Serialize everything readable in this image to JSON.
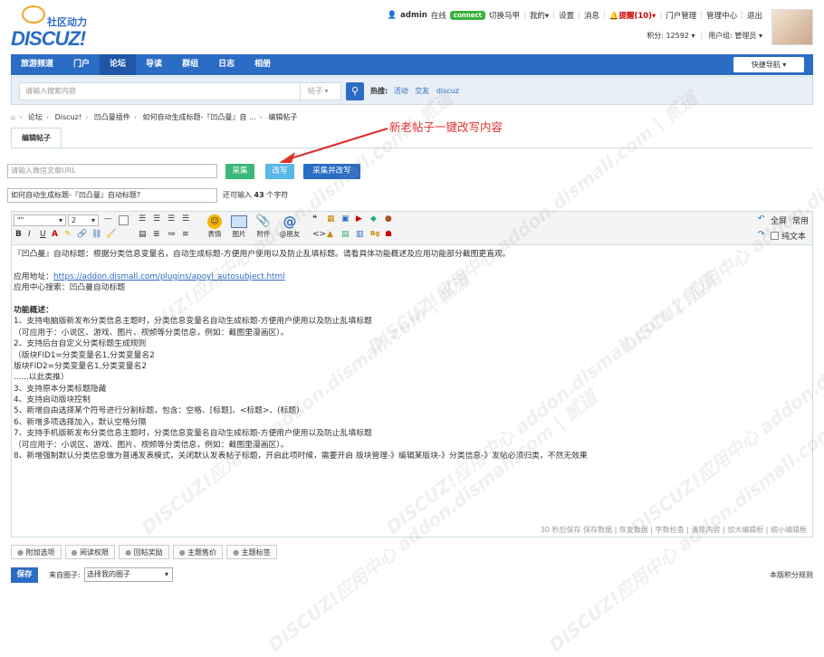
{
  "logo": {
    "cn": "社区动力",
    "en": "DISCUZ!"
  },
  "user": {
    "name": "admin",
    "status": "在线",
    "connect": "connect",
    "switch": "切换马甲",
    "mine": "我的",
    "settings": "设置",
    "messages": "消息",
    "remind": "提醒(10)",
    "admin_portal": "门户管理",
    "admin_center": "管理中心",
    "logout": "退出",
    "points": "积分: 12592",
    "group": "用户组: 管理员"
  },
  "nav": {
    "items": [
      "旅游频道",
      "门户",
      "论坛",
      "导读",
      "群组",
      "日志",
      "相册"
    ],
    "active": 2,
    "quick": "快捷导航"
  },
  "search": {
    "placeholder": "请输入搜索内容",
    "type": "帖子",
    "hot_label": "热搜:",
    "hot": [
      "活动",
      "交友",
      "discuz"
    ]
  },
  "breadcrumb": [
    "论坛",
    "Discuz!",
    "凹凸曼插件",
    "如何自动生成标题-『凹凸曼』自 ...",
    "编辑帖子"
  ],
  "tab": "编辑帖子",
  "annotation": "新老帖子一键改写内容",
  "url_input": {
    "placeholder": "请输入微信文章URL"
  },
  "buttons": {
    "collect": "采集",
    "rewrite": "改写",
    "collect_rewrite": "采集并改写"
  },
  "title_input": {
    "value": "如何自动生成标题-『凹凸曼』自动标题?"
  },
  "char_count": {
    "prefix": "还可输入",
    "num": "43",
    "suffix": "个字符"
  },
  "toolbar": {
    "font": "\"\"",
    "size": "2",
    "emoji": "表情",
    "image": "图片",
    "attach": "附件",
    "at": "@朋友",
    "fullscreen": "全屏",
    "common": "常用",
    "plaintext": "纯文本"
  },
  "content": [
    "『凹凸曼』自动标题：根据分类信息变量名，自动生成标题-方便用户使用以及防止乱填标题。请看具体功能概述及应用功能部分截图更直观。",
    "",
    "应用地址：",
    "应用中心搜索：凹凸曼自动标题",
    "",
    "功能概述：",
    "1、支持电脑版新发布分类信息主题时，分类信息变量名自动生成标题-方便用户使用以及防止乱填标题",
    "（可应用于：小说区、游戏、图片、视频等分类信息，例如：截图里漫画区）。",
    "2、支持后台自定义分类标题生成规则",
    "（版块FID1=分类变量名1,分类变量名2",
    "  版块FID2=分类变量名1,分类变量名2",
    "  ......以此类推）",
    "3、支持原本分类标题隐藏",
    "4、支持启动版块控制",
    "5、新增自由选择某个符号进行分割标题，包含：空格、[标题]、<标题>、(标题)",
    "6、新增多项选择加入，默认空格分隔",
    "7、支持手机版新发布分类信息主题时，分类信息变量名自动生成标题-方便用户使用以及防止乱填标题",
    "（可应用于：小说区、游戏、图片、视频等分类信息，例如：截图里漫画区）。",
    "8、新增强制默认分类信息做为普通发表模式，关闭默认发表帖子标题，开启此项时候，需要开启 版块管理-》编辑某版块-》分类信息-》发帖必须归类，不然无效果"
  ],
  "link": "https://addon.dismall.com/plugins/apoyl_autosubject.html",
  "status_bar": "30 秒后保存 保存数据 | 恢复数据 | 字数检查 | 清除内容 | 加大编辑框 | 缩小编辑框",
  "options": [
    "附加选项",
    "阅读权限",
    "回帖奖励",
    "主题售价",
    "主题标签"
  ],
  "save": "保存",
  "from_label": "来自圈子:",
  "from_select": "选择我的圈子",
  "credit_rule": "本版积分规则",
  "watermark": "DISCUZ!应用中心 addon.dismall.com | 贰道"
}
